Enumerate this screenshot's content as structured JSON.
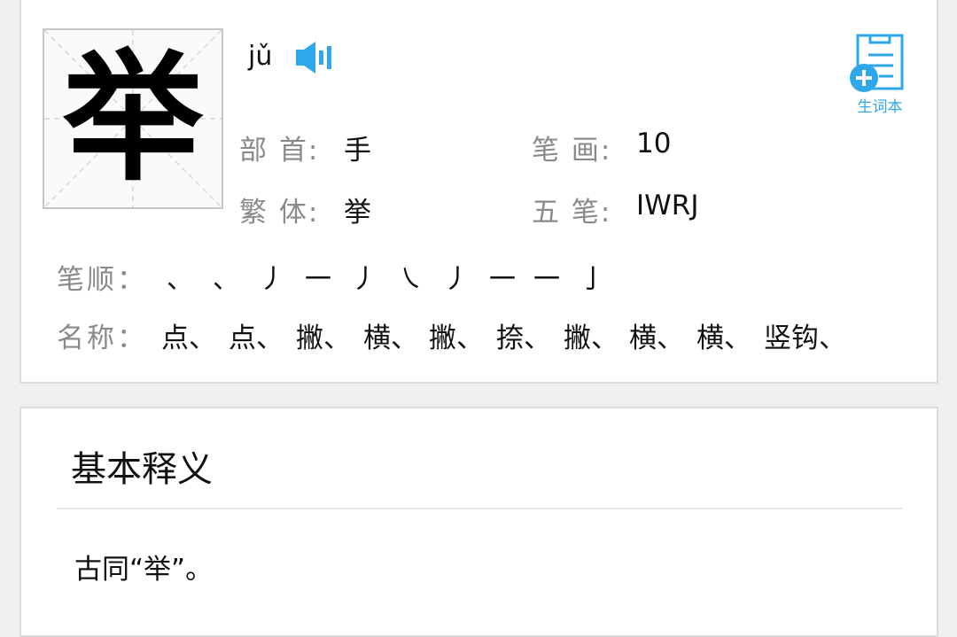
{
  "character": {
    "glyph": "举",
    "pinyin": "jǔ"
  },
  "vocab_button": {
    "label": "生词本"
  },
  "info": {
    "radical_label": "部 首:",
    "radical_value": "手",
    "strokes_label": "笔 画:",
    "strokes_value": "10",
    "traditional_label": "繁 体:",
    "traditional_value": "挙",
    "wubi_label": "五 笔:",
    "wubi_value": "IWRJ"
  },
  "stroke_order": {
    "label": "笔顺：",
    "strokes": [
      "、",
      "、",
      "丿",
      "一",
      "丿",
      "㇏",
      "丿",
      "一",
      "一",
      "亅"
    ]
  },
  "stroke_names": {
    "label": "名称：",
    "names": [
      "点、",
      "点、",
      "撇、",
      "横、",
      "撇、",
      "捺、",
      "撇、",
      "横、",
      "横、",
      "竖钩、"
    ]
  },
  "basic_definition": {
    "title": "基本释义",
    "text": "古同“举”。"
  },
  "colors": {
    "accent": "#2ea8ea",
    "label_gray": "#8a8a8a",
    "background": "#efefef"
  },
  "icons": {
    "speaker": "speaker-icon",
    "vocab": "add-notebook-icon"
  }
}
